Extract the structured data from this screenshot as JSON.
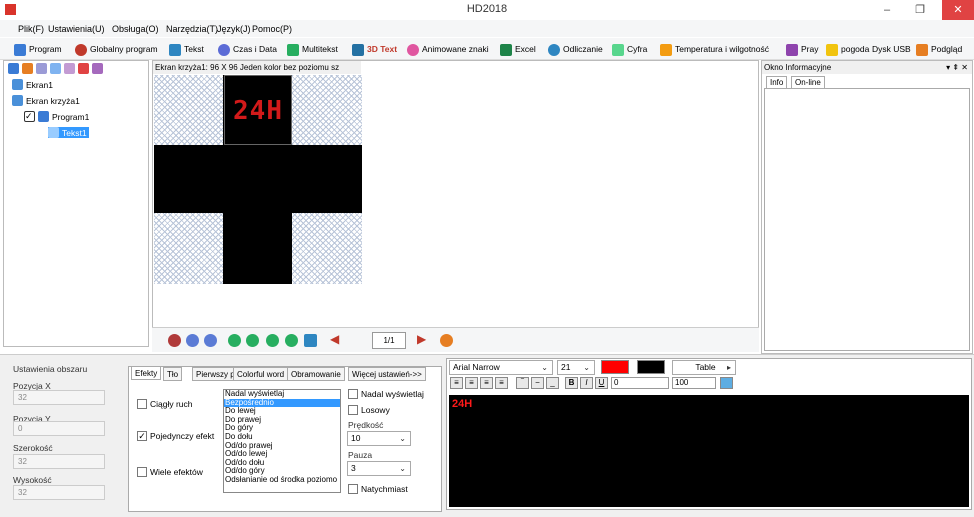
{
  "window": {
    "title": "HD2018",
    "minimize": "–",
    "restore": "❐",
    "close": "✕"
  },
  "menu": [
    "Plik(F)",
    "Ustawienia(U)",
    "Obsługa(O)",
    "Narzędzia(T)",
    "Język(J)",
    "Pomoc(P)"
  ],
  "toolbar": {
    "items": [
      {
        "label": "Program",
        "color": "#3a7bd5"
      },
      {
        "label": "Globalny program",
        "color": "#c0392b"
      },
      {
        "label": "Tekst",
        "color": "#2e86c1"
      },
      {
        "label": "Czas i Data",
        "color": "#5b6bd6"
      },
      {
        "label": "Multitekst",
        "color": "#27ae60"
      },
      {
        "label": "3D Text",
        "color": "#2471a3"
      },
      {
        "label": "Animowane znaki",
        "color": "#e056a0"
      },
      {
        "label": "Excel",
        "color": "#1e8449"
      },
      {
        "label": "Odliczanie",
        "color": "#2e86c1"
      },
      {
        "label": "Cyfra",
        "color": "#58d68d"
      },
      {
        "label": "Temperatura i wilgotność",
        "color": "#f39c12"
      },
      {
        "label": "Pray",
        "color": "#8e44ad"
      },
      {
        "label": "pogoda",
        "color": "#f1c40f"
      },
      {
        "label": "Dysk USB",
        "color": "#f5f6f7"
      },
      {
        "label": "Podgląd",
        "color": "#e67e22"
      }
    ]
  },
  "tree": {
    "nodes": [
      "Ekran1",
      "Ekran krzyża1",
      "Program1",
      "Tekst1"
    ]
  },
  "preview": {
    "header": "Ekran krzyża1: 96 X 96  Jeden kolor  bez poziomu sz",
    "led_text": "24H"
  },
  "nav": {
    "page": "1/1"
  },
  "info": {
    "title": "Okno Informacyjne",
    "tabs": [
      "Info",
      "On-line"
    ],
    "pin": "▾ ⇞ ✕"
  },
  "area": {
    "title": "Ustawienia obszaru",
    "pos_x_label": "Pozycja X",
    "pos_x": "32",
    "pos_y_label": "Pozycja Y",
    "pos_y": "0",
    "width_label": "Szerokość",
    "width": "32",
    "height_label": "Wysokość",
    "height": "32"
  },
  "effects": {
    "tabs": [
      "Efekty",
      "Tło",
      "Pierwszy plan",
      "Colorful word",
      "Obramowanie",
      "Więcej ustawień->>"
    ],
    "continuous": "Ciągły ruch",
    "single": "Pojedynczy efekt",
    "multi": "Wiele efektów",
    "list": [
      "Nadal wyświetlaj",
      "Bezpośrednio",
      "Do lewej",
      "Do prawej",
      "Do góry",
      "Do dołu",
      "Od/do prawej",
      "Od/do lewej",
      "Od/do dołu",
      "Od/do góry",
      "Odsłanianie od środka poziomo"
    ],
    "keep_show": "Nadal wyświetlaj",
    "random": "Losowy",
    "speed_label": "Prędkość",
    "speed": "10",
    "pause_label": "Pauza",
    "pause": "3",
    "instant": "Natychmiast"
  },
  "editor": {
    "font": "Arial Narrow",
    "size": "21",
    "table": "Table",
    "spacing": "0",
    "scale": "100",
    "text": "24H",
    "text_color": "#ff0000",
    "bg_color": "#000000"
  }
}
